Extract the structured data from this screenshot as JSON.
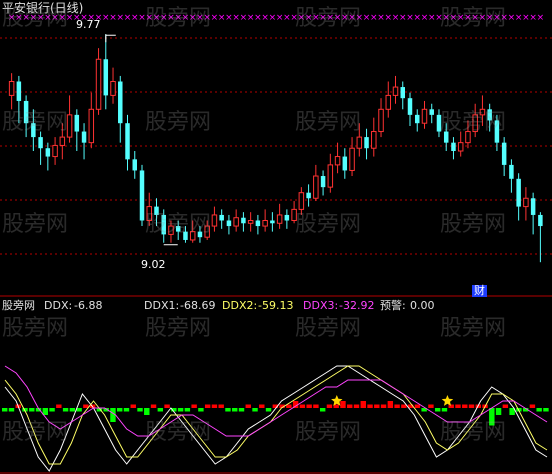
{
  "title": "平安银行(日线)",
  "watermark": "股旁网",
  "colors": {
    "bg": "#000000",
    "up": "#ff3232",
    "down": "#54ffff",
    "grid": "#b40000",
    "cross": "#ff00ff",
    "ddx_green": "#00ff00",
    "ddx_red": "#ff0000",
    "star": "#ffd700",
    "dark_blue": "#1e3cff"
  },
  "indicator": {
    "source_label": "股旁网",
    "ddx_label": "DDX:",
    "ddx_value": "-6.88",
    "ddx1_label": "DDX1:",
    "ddx1_value": "-68.69",
    "ddx2_label": "DDX2:",
    "ddx2_value": "-59.13",
    "ddx3_label": "DDX3:",
    "ddx3_value": "-32.92",
    "warn_label": "预警:",
    "warn_value": "0.00"
  },
  "annotations": {
    "high_label": "9.77",
    "low_label": "9.02",
    "badge": "财"
  },
  "chart_data": {
    "type": "candlestick",
    "price_range": [
      8.85,
      9.85
    ],
    "high_marker": 9.77,
    "low_marker": 9.02,
    "candles": [
      [
        9.55,
        9.6,
        9.5,
        9.63
      ],
      [
        9.6,
        9.53,
        9.45,
        9.62
      ],
      [
        9.53,
        9.45,
        9.4,
        9.55
      ],
      [
        9.45,
        9.4,
        9.35,
        9.5
      ],
      [
        9.4,
        9.36,
        9.3,
        9.42
      ],
      [
        9.36,
        9.33,
        9.28,
        9.38
      ],
      [
        9.33,
        9.37,
        9.3,
        9.4
      ],
      [
        9.37,
        9.4,
        9.32,
        9.45
      ],
      [
        9.4,
        9.48,
        9.38,
        9.55
      ],
      [
        9.48,
        9.42,
        9.35,
        9.5
      ],
      [
        9.42,
        9.38,
        9.32,
        9.45
      ],
      [
        9.38,
        9.5,
        9.36,
        9.56
      ],
      [
        9.5,
        9.68,
        9.48,
        9.72
      ],
      [
        9.68,
        9.55,
        9.5,
        9.77
      ],
      [
        9.55,
        9.6,
        9.52,
        9.65
      ],
      [
        9.6,
        9.45,
        9.38,
        9.62
      ],
      [
        9.45,
        9.32,
        9.28,
        9.48
      ],
      [
        9.32,
        9.28,
        9.25,
        9.35
      ],
      [
        9.28,
        9.1,
        9.08,
        9.3
      ],
      [
        9.1,
        9.15,
        9.08,
        9.2
      ],
      [
        9.15,
        9.12,
        9.08,
        9.18
      ],
      [
        9.12,
        9.05,
        9.02,
        9.14
      ],
      [
        9.05,
        9.08,
        9.02,
        9.1
      ],
      [
        9.08,
        9.06,
        9.03,
        9.1
      ],
      [
        9.06,
        9.03,
        9.02,
        9.08
      ],
      [
        9.03,
        9.06,
        9.02,
        9.1
      ],
      [
        9.06,
        9.04,
        9.02,
        9.08
      ],
      [
        9.04,
        9.08,
        9.03,
        9.1
      ],
      [
        9.08,
        9.12,
        9.06,
        9.15
      ],
      [
        9.12,
        9.1,
        9.07,
        9.14
      ],
      [
        9.1,
        9.08,
        9.05,
        9.12
      ],
      [
        9.08,
        9.11,
        9.06,
        9.14
      ],
      [
        9.11,
        9.09,
        9.06,
        9.13
      ],
      [
        9.09,
        9.1,
        9.06,
        9.13
      ],
      [
        9.1,
        9.08,
        9.05,
        9.12
      ],
      [
        9.08,
        9.1,
        9.06,
        9.14
      ],
      [
        9.1,
        9.09,
        9.06,
        9.13
      ],
      [
        9.09,
        9.12,
        9.07,
        9.16
      ],
      [
        9.12,
        9.1,
        9.07,
        9.14
      ],
      [
        9.1,
        9.14,
        9.09,
        9.17
      ],
      [
        9.14,
        9.2,
        9.12,
        9.22
      ],
      [
        9.2,
        9.18,
        9.15,
        9.23
      ],
      [
        9.18,
        9.26,
        9.17,
        9.3
      ],
      [
        9.26,
        9.22,
        9.19,
        9.28
      ],
      [
        9.22,
        9.3,
        9.2,
        9.34
      ],
      [
        9.3,
        9.33,
        9.27,
        9.38
      ],
      [
        9.33,
        9.28,
        9.25,
        9.36
      ],
      [
        9.28,
        9.36,
        9.26,
        9.4
      ],
      [
        9.36,
        9.4,
        9.33,
        9.45
      ],
      [
        9.4,
        9.36,
        9.32,
        9.43
      ],
      [
        9.36,
        9.42,
        9.33,
        9.47
      ],
      [
        9.42,
        9.5,
        9.4,
        9.54
      ],
      [
        9.5,
        9.55,
        9.47,
        9.6
      ],
      [
        9.55,
        9.58,
        9.52,
        9.62
      ],
      [
        9.58,
        9.54,
        9.5,
        9.6
      ],
      [
        9.54,
        9.48,
        9.44,
        9.56
      ],
      [
        9.48,
        9.45,
        9.42,
        9.5
      ],
      [
        9.45,
        9.5,
        9.43,
        9.53
      ],
      [
        9.5,
        9.48,
        9.45,
        9.52
      ],
      [
        9.48,
        9.42,
        9.4,
        9.5
      ],
      [
        9.42,
        9.38,
        9.35,
        9.45
      ],
      [
        9.38,
        9.35,
        9.32,
        9.4
      ],
      [
        9.35,
        9.38,
        9.33,
        9.42
      ],
      [
        9.38,
        9.42,
        9.36,
        9.46
      ],
      [
        9.42,
        9.48,
        9.4,
        9.52
      ],
      [
        9.48,
        9.5,
        9.44,
        9.55
      ],
      [
        9.5,
        9.46,
        9.42,
        9.52
      ],
      [
        9.46,
        9.38,
        9.35,
        9.48
      ],
      [
        9.38,
        9.3,
        9.26,
        9.4
      ],
      [
        9.3,
        9.25,
        9.2,
        9.32
      ],
      [
        9.25,
        9.15,
        9.1,
        9.27
      ],
      [
        9.15,
        9.18,
        9.1,
        9.22
      ],
      [
        9.18,
        9.12,
        9.05,
        9.2
      ],
      [
        9.12,
        9.08,
        8.95,
        9.13
      ]
    ],
    "ddx_bars": [
      -1,
      -1,
      1,
      -1,
      -1,
      -1,
      -2,
      -1,
      1,
      -1,
      -1,
      -1,
      1,
      1,
      -1,
      -1,
      -4,
      -1,
      -1,
      1,
      -1,
      -2,
      1,
      -1,
      1,
      -1,
      -1,
      -1,
      1,
      -1,
      1,
      1,
      1,
      -1,
      -1,
      -1,
      1,
      -1,
      1,
      -1,
      1,
      1,
      1,
      2,
      1,
      1,
      1,
      -1,
      1,
      1,
      2,
      1,
      1,
      2,
      1,
      1,
      1,
      2,
      1,
      1,
      1,
      1,
      -1,
      1,
      -1,
      -1,
      1,
      1,
      1,
      1,
      1,
      1,
      -5,
      -2,
      1,
      -2,
      -1,
      -1,
      1,
      -1,
      -1
    ],
    "ddx_range": [
      -6,
      6
    ],
    "ddx1": [
      0.3,
      0.1,
      -0.3,
      -0.7,
      -0.9,
      -0.6,
      -0.2,
      0.2,
      0.0,
      -0.3,
      -0.6,
      -0.8,
      -0.6,
      -0.4,
      -0.2,
      0.0,
      -0.2,
      -0.4,
      -0.6,
      -0.8,
      -0.7,
      -0.5,
      -0.3,
      -0.2,
      -0.1,
      0.1,
      0.2,
      0.3,
      0.4,
      0.5,
      0.6,
      0.6,
      0.5,
      0.4,
      0.3,
      0.2,
      0.1,
      -0.1,
      -0.4,
      -0.7,
      -0.6,
      -0.4,
      -0.2,
      0.1,
      0.3,
      0.2,
      0.0,
      -0.3,
      -0.6,
      -0.7
    ],
    "ddx2": [
      0.4,
      0.2,
      -0.1,
      -0.5,
      -0.8,
      -0.8,
      -0.5,
      -0.1,
      0.1,
      -0.1,
      -0.4,
      -0.7,
      -0.7,
      -0.5,
      -0.3,
      -0.1,
      -0.1,
      -0.3,
      -0.5,
      -0.7,
      -0.7,
      -0.6,
      -0.4,
      -0.3,
      -0.2,
      0.0,
      0.1,
      0.2,
      0.3,
      0.4,
      0.5,
      0.6,
      0.6,
      0.5,
      0.4,
      0.3,
      0.2,
      0.0,
      -0.2,
      -0.5,
      -0.6,
      -0.5,
      -0.3,
      -0.1,
      0.2,
      0.2,
      0.1,
      -0.2,
      -0.5,
      -0.6
    ],
    "ddx3": [
      0.6,
      0.5,
      0.3,
      0.0,
      -0.2,
      -0.3,
      -0.2,
      -0.1,
      0.0,
      0.0,
      -0.1,
      -0.3,
      -0.4,
      -0.4,
      -0.3,
      -0.2,
      -0.1,
      -0.1,
      -0.2,
      -0.3,
      -0.4,
      -0.4,
      -0.4,
      -0.3,
      -0.2,
      -0.1,
      0.0,
      0.1,
      0.2,
      0.3,
      0.3,
      0.4,
      0.4,
      0.4,
      0.4,
      0.3,
      0.2,
      0.1,
      0.0,
      -0.1,
      -0.2,
      -0.2,
      -0.2,
      -0.1,
      0.0,
      0.1,
      0.1,
      0.0,
      -0.1,
      -0.2
    ],
    "stars_at": [
      30,
      40,
      50
    ]
  }
}
